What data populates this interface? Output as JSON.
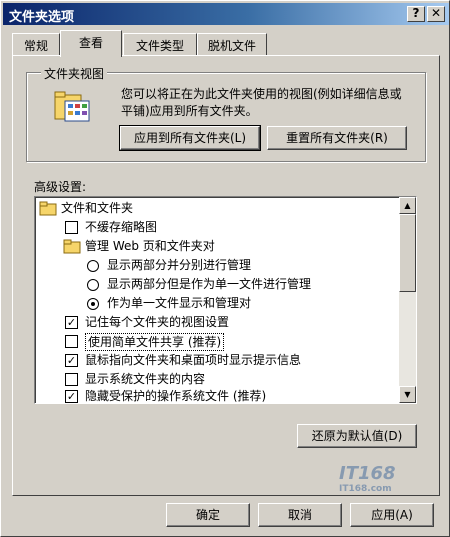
{
  "window": {
    "title": "文件夹选项",
    "help_btn": "?",
    "close_btn": "✕"
  },
  "tabs": [
    {
      "label": "常规",
      "active": false
    },
    {
      "label": "查看",
      "active": true
    },
    {
      "label": "文件类型",
      "active": false
    },
    {
      "label": "脱机文件",
      "active": false
    }
  ],
  "folder_views": {
    "group_label": "文件夹视图",
    "description": "您可以将正在为此文件夹使用的视图(例如详细信息或平铺)应用到所有文件夹。",
    "apply_all_label": "应用到所有文件夹(L)",
    "reset_all_label": "重置所有文件夹(R)"
  },
  "advanced": {
    "label": "高级设置:",
    "items": [
      {
        "type": "folder",
        "indent": 0,
        "text": "文件和文件夹"
      },
      {
        "type": "checkbox",
        "indent": 1,
        "checked": false,
        "text": "不缓存缩略图"
      },
      {
        "type": "folder",
        "indent": 1,
        "text": "管理 Web 页和文件夹对"
      },
      {
        "type": "radio",
        "indent": 2,
        "checked": false,
        "text": "显示两部分并分别进行管理"
      },
      {
        "type": "radio",
        "indent": 2,
        "checked": false,
        "text": "显示两部分但是作为单一文件进行管理"
      },
      {
        "type": "radio",
        "indent": 2,
        "checked": true,
        "text": "作为单一文件显示和管理对"
      },
      {
        "type": "checkbox",
        "indent": 1,
        "checked": true,
        "text": "记住每个文件夹的视图设置"
      },
      {
        "type": "checkbox",
        "indent": 1,
        "checked": false,
        "text": "使用简单文件共享 (推荐)",
        "focused": true
      },
      {
        "type": "checkbox",
        "indent": 1,
        "checked": true,
        "text": "鼠标指向文件夹和桌面项时显示提示信息"
      },
      {
        "type": "checkbox",
        "indent": 1,
        "checked": false,
        "text": "显示系统文件夹的内容"
      },
      {
        "type": "checkbox",
        "indent": 1,
        "checked": true,
        "text": "隐藏受保护的操作系统文件 (推荐)"
      }
    ],
    "restore_defaults_label": "还原为默认值(D)"
  },
  "dialog_buttons": {
    "ok_label": "确定",
    "cancel_label": "取消",
    "apply_label": "应用(A)"
  },
  "watermark": {
    "text": "IT168",
    "sub": "IT168.com"
  }
}
